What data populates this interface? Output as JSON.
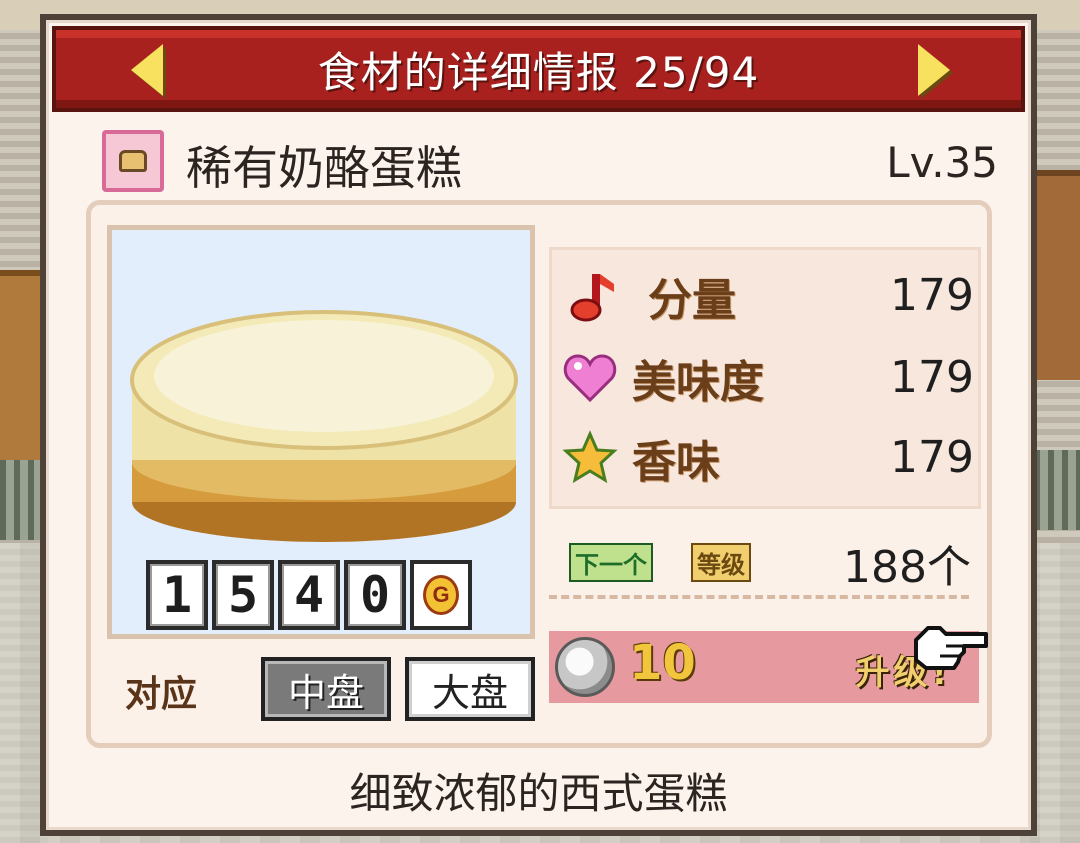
{
  "header": {
    "title": "食材的详细情报 25/94",
    "prev_icon": "arrow-left-icon",
    "next_icon": "arrow-right-icon"
  },
  "item": {
    "name": "稀有奶酪蛋糕",
    "level": "Lv.35",
    "type_icon": "food-category-icon",
    "image": "cheesecake",
    "price_digits": [
      "1",
      "5",
      "4",
      "0"
    ],
    "currency_symbol": "G"
  },
  "dish_size": {
    "label": "对应",
    "options": [
      "中盘",
      "大盘"
    ],
    "selected": "中盘"
  },
  "stats": [
    {
      "icon": "music-note-icon",
      "label": "分量",
      "value": "179"
    },
    {
      "icon": "heart-icon",
      "label": "美味度",
      "value": "179"
    },
    {
      "icon": "star-icon",
      "label": "香味",
      "value": "179"
    }
  ],
  "next_level": {
    "tag1": "下一个",
    "tag2": "等级",
    "count": "188个"
  },
  "upgrade": {
    "coin_icon": "silver-coin-icon",
    "cost": "10",
    "label": "升级!"
  },
  "description": "细致浓郁的西式蛋糕",
  "colors": {
    "title_bar": "#a8211e",
    "panel": "#fbf3ec",
    "upgrade_bar": "#e69aa0",
    "stat_label": "#6b3e1a"
  }
}
